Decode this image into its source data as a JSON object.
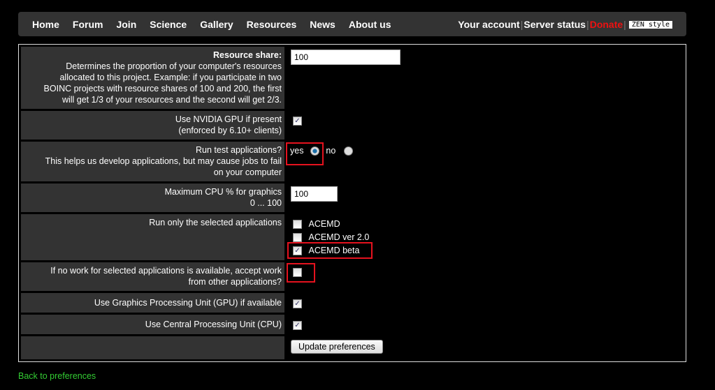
{
  "nav": {
    "left": [
      "Home",
      "Forum",
      "Join",
      "Science",
      "Gallery",
      "Resources",
      "News",
      "About us"
    ],
    "account": "Your account",
    "server": "Server status",
    "donate": "Donate",
    "zen": "ZEN style"
  },
  "prefs": {
    "resource_title": "Resource share:",
    "resource_desc": "Determines the proportion of your computer's resources allocated to this project. Example: if you participate in two BOINC projects with resource shares of 100 and 200, the first will get 1/3 of your resources and the second will get 2/3.",
    "resource_value": "100",
    "nvidia_label": "Use NVIDIA GPU if present",
    "nvidia_sub": "(enforced by 6.10+ clients)",
    "test_label": "Run test applications?",
    "test_sub": "This helps us develop applications, but may cause jobs to fail on your computer",
    "yes": "yes",
    "no": "no",
    "cpu_label": "Maximum CPU % for graphics",
    "cpu_range": "0 ... 100",
    "cpu_value": "100",
    "apps_label": "Run only the selected applications",
    "apps": [
      "ACEMD",
      "ACEMD ver 2.0",
      "ACEMD beta"
    ],
    "other_label": "If no work for selected applications is available, accept work from other applications?",
    "gpu_label": "Use Graphics Processing Unit (GPU) if available",
    "cpuuse_label": "Use Central Processing Unit (CPU)",
    "update": "Update preferences"
  },
  "back": "Back to preferences"
}
